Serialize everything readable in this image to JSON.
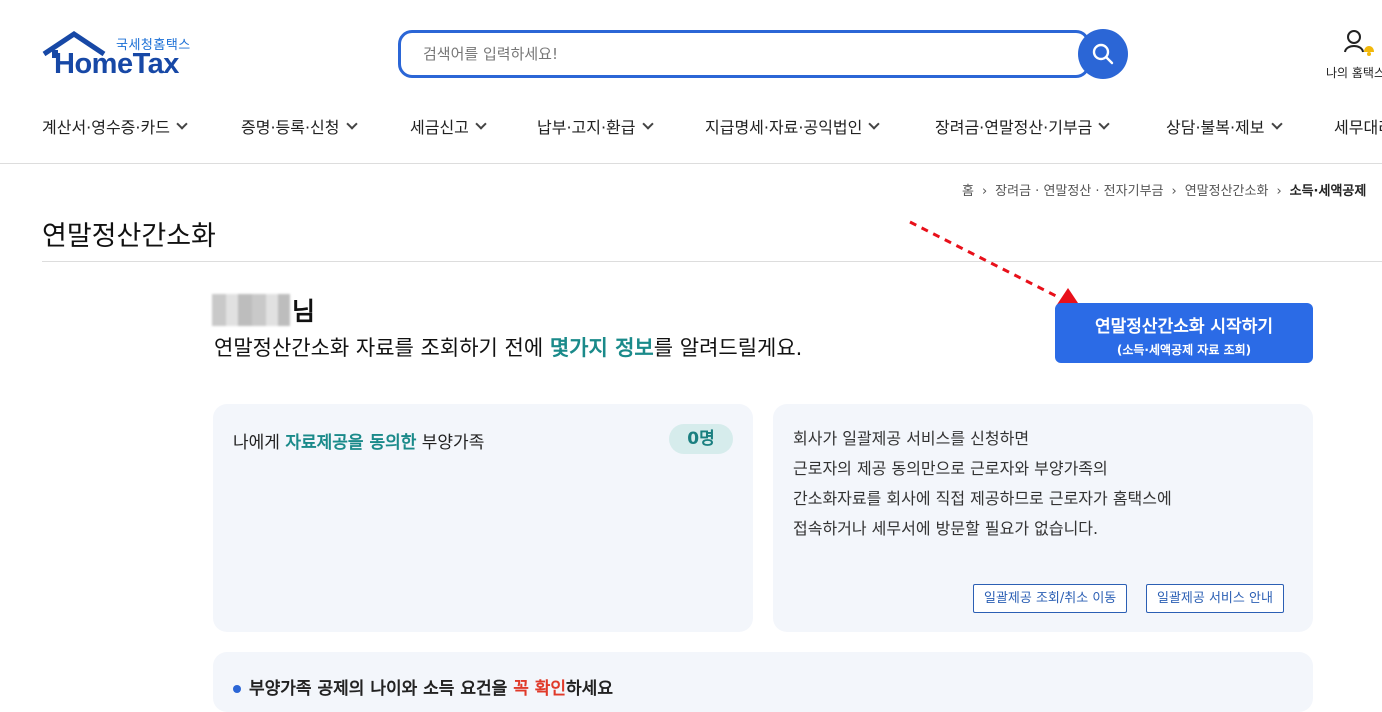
{
  "header": {
    "logo_sub": "국세청홈택스",
    "logo_main": "HomeTax",
    "search_placeholder": "검색어를 입력하세요!",
    "my_hometax_label": "나의 홈택스"
  },
  "nav": {
    "items": [
      {
        "label": "계산서·영수증·카드"
      },
      {
        "label": "증명·등록·신청"
      },
      {
        "label": "세금신고"
      },
      {
        "label": "납부·고지·환급"
      },
      {
        "label": "지급명세·자료·공익법인"
      },
      {
        "label": "장려금·연말정산·기부금"
      },
      {
        "label": "상담·불복·제보"
      },
      {
        "label": "세무대리"
      }
    ]
  },
  "breadcrumb": {
    "items": [
      "홈",
      "장려금 · 연말정산 · 전자기부금",
      "연말정산간소화"
    ],
    "current": "소득·세액공제"
  },
  "page": {
    "title": "연말정산간소화",
    "greet_suffix": "님",
    "greet_msg_pre": "연말정산간소화 자료를 조회하기 전에 ",
    "greet_msg_hl": "몇가지 정보",
    "greet_msg_post": "를 알려드릴게요.",
    "start_button_line1": "연말정산간소화 시작하기",
    "start_button_line2": "(소득·세액공제 자료 조회)"
  },
  "card_left": {
    "label_pre": "나에게 ",
    "label_hl": "자료제공을 동의한",
    "label_post": " 부양가족",
    "count": "0명"
  },
  "card_right": {
    "lines": [
      "회사가 일괄제공 서비스를 신청하면",
      "근로자의 제공 동의만으로 근로자와 부양가족의",
      "간소화자료를 회사에 직접 제공하므로 근로자가 홈택스에",
      "접속하거나 세무서에 방문할 필요가 없습니다."
    ],
    "button_inquiry": "일괄제공 조회/취소 이동",
    "button_guide": "일괄제공 서비스 안내"
  },
  "card_bottom": {
    "text_pre": "부양가족 공제의 나이와 소득 요건을 ",
    "text_red": "꼭 확인",
    "text_post": "하세요"
  },
  "colors": {
    "brand_blue": "#2b66d6",
    "accent_teal": "#1a8a8a",
    "arrow_red": "#e8101a"
  }
}
